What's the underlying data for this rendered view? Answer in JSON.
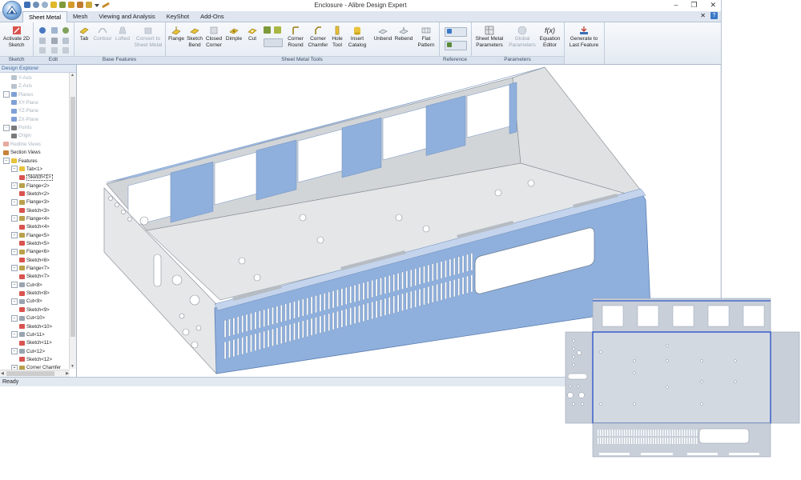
{
  "window": {
    "title": "Enclosure - Alibre Design Expert",
    "controls": [
      "–",
      "❐",
      "✕"
    ]
  },
  "menu_tabs": [
    "Sheet Metal",
    "Mesh",
    "Viewing and Analysis",
    "KeyShot",
    "Add-Ons"
  ],
  "help": {
    "close": "✕",
    "question": "?"
  },
  "ribbon": {
    "groups": {
      "sketch": "Sketch",
      "edit": "Edit",
      "base_features": "Base Features",
      "sheet_metal_tools": "Sheet Metal Tools",
      "reference": "Reference",
      "parameters": "Parameters"
    },
    "buttons": {
      "activate_sketch": "Activate 2D Sketch",
      "tab": "Tab",
      "contour": "Contour",
      "lofted": "Lofted",
      "convert": "Convert to Sheet Metal",
      "flange": "Flange",
      "sketch_bend": "Sketch Bend",
      "closed_corner": "Closed Corner",
      "dimple": "Dimple",
      "cut": "Cut",
      "corner_round": "Corner Round",
      "corner_chamfer": "Corner Chamfer",
      "hole_tool": "Hole Tool",
      "insert_catalog": "Insert Catalog",
      "unbend": "Unbend",
      "rebend": "Rebend",
      "flat_pattern": "Flat Pattern",
      "sheet_metal_parameters": "Sheet Metal Parameters",
      "global_parameters": "Global Parameters",
      "equation_editor": "Equation Editor",
      "equation_symbol": "f(x)",
      "generate_last_feature": "Generate to Last Feature"
    }
  },
  "tree": {
    "header": "Design Explorer",
    "rows": [
      {
        "label": "Y-Axis",
        "level": 2,
        "dim": true,
        "icon": "axis-icon"
      },
      {
        "label": "Z-Axis",
        "level": 2,
        "dim": true,
        "icon": "axis-icon"
      },
      {
        "label": "Planes",
        "level": 1,
        "dim": true,
        "icon": "plane-icon",
        "toggle": "−"
      },
      {
        "label": "XY-Plane",
        "level": 2,
        "dim": true,
        "icon": "plane-icon"
      },
      {
        "label": "YZ-Plane",
        "level": 2,
        "dim": true,
        "icon": "plane-icon"
      },
      {
        "label": "ZX-Plane",
        "level": 2,
        "dim": true,
        "icon": "plane-icon"
      },
      {
        "label": "Points",
        "level": 1,
        "dim": true,
        "icon": "point-icon",
        "toggle": "−"
      },
      {
        "label": "Origin",
        "level": 2,
        "dim": true,
        "icon": "point-icon"
      },
      {
        "label": "Redline Views",
        "level": 1,
        "dim": true,
        "icon": "redline-icon"
      },
      {
        "label": "Section Views",
        "level": 1,
        "dim": false,
        "icon": "section-icon"
      },
      {
        "label": "Features",
        "level": 1,
        "dim": false,
        "icon": "feature-icon",
        "toggle": "−"
      },
      {
        "label": "Tab<1>",
        "level": 2,
        "dim": false,
        "icon": "tab-icon",
        "toggle": "−"
      },
      {
        "label": "Sketch<1>",
        "level": 3,
        "dim": false,
        "icon": "sketch-icon",
        "selected": true
      },
      {
        "label": "Flange<2>",
        "level": 2,
        "dim": false,
        "icon": "flange-icon",
        "toggle": "−"
      },
      {
        "label": "Sketch<2>",
        "level": 3,
        "dim": false,
        "icon": "sketch-icon"
      },
      {
        "label": "Flange<3>",
        "level": 2,
        "dim": false,
        "icon": "flange-icon",
        "toggle": "−"
      },
      {
        "label": "Sketch<3>",
        "level": 3,
        "dim": false,
        "icon": "sketch-icon"
      },
      {
        "label": "Flange<4>",
        "level": 2,
        "dim": false,
        "icon": "flange-icon",
        "toggle": "−"
      },
      {
        "label": "Sketch<4>",
        "level": 3,
        "dim": false,
        "icon": "sketch-icon"
      },
      {
        "label": "Flange<5>",
        "level": 2,
        "dim": false,
        "icon": "flange-icon",
        "toggle": "−"
      },
      {
        "label": "Sketch<5>",
        "level": 3,
        "dim": false,
        "icon": "sketch-icon"
      },
      {
        "label": "Flange<6>",
        "level": 2,
        "dim": false,
        "icon": "flange-icon",
        "toggle": "−"
      },
      {
        "label": "Sketch<6>",
        "level": 3,
        "dim": false,
        "icon": "sketch-icon"
      },
      {
        "label": "Flange<7>",
        "level": 2,
        "dim": false,
        "icon": "flange-icon",
        "toggle": "−"
      },
      {
        "label": "Sketch<7>",
        "level": 3,
        "dim": false,
        "icon": "sketch-icon"
      },
      {
        "label": "Cut<8>",
        "level": 2,
        "dim": false,
        "icon": "cut-icon",
        "toggle": "−"
      },
      {
        "label": "Sketch<8>",
        "level": 3,
        "dim": false,
        "icon": "sketch-icon"
      },
      {
        "label": "Cut<9>",
        "level": 2,
        "dim": false,
        "icon": "cut-icon",
        "toggle": "−"
      },
      {
        "label": "Sketch<9>",
        "level": 3,
        "dim": false,
        "icon": "sketch-icon"
      },
      {
        "label": "Cut<10>",
        "level": 2,
        "dim": false,
        "icon": "cut-icon",
        "toggle": "−"
      },
      {
        "label": "Sketch<10>",
        "level": 3,
        "dim": false,
        "icon": "sketch-icon"
      },
      {
        "label": "Cut<11>",
        "level": 2,
        "dim": false,
        "icon": "cut-icon",
        "toggle": "−"
      },
      {
        "label": "Sketch<11>",
        "level": 3,
        "dim": false,
        "icon": "sketch-icon"
      },
      {
        "label": "Cut<12>",
        "level": 2,
        "dim": false,
        "icon": "cut-icon",
        "toggle": "−"
      },
      {
        "label": "Sketch<12>",
        "level": 3,
        "dim": false,
        "icon": "sketch-icon"
      },
      {
        "label": "Corner Chamfer",
        "level": 2,
        "dim": false,
        "icon": "chamfer-icon",
        "toggle": "+"
      }
    ]
  },
  "status": "Ready",
  "colors": {
    "sheet_blue": "#8fb0dd",
    "sheet_grey": "#d9dcdf",
    "ribbon_bg": "#eef2f7",
    "accent_blue": "#3a78c8",
    "flat_outline": "#2e58c8"
  }
}
